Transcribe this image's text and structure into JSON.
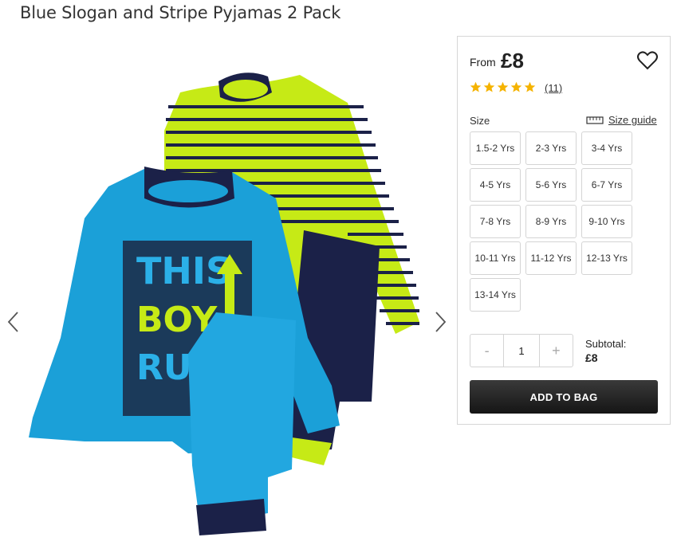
{
  "product": {
    "title": "Blue Slogan and Stripe Pyjamas 2 Pack",
    "image_alt": "Blue slogan pyjamas with lime and navy stripe pyjamas",
    "print": {
      "line1": "THIS",
      "line2": "BOY",
      "line3": "RUL"
    }
  },
  "gallery": {
    "prev_icon": "chevron-left-icon",
    "next_icon": "chevron-right-icon"
  },
  "purchase": {
    "from_label": "From",
    "price": "£8",
    "rating": 5,
    "review_count": "(11)",
    "size_label": "Size",
    "size_guide_label": "Size guide",
    "sizes": [
      "1.5-2 Yrs",
      "2-3 Yrs",
      "3-4 Yrs",
      "4-5 Yrs",
      "5-6 Yrs",
      "6-7 Yrs",
      "7-8 Yrs",
      "8-9 Yrs",
      "9-10 Yrs",
      "10-11 Yrs",
      "11-12 Yrs",
      "12-13 Yrs",
      "13-14 Yrs"
    ],
    "qty_minus": "-",
    "qty_value": "1",
    "qty_plus": "+",
    "subtotal_label": "Subtotal:",
    "subtotal_value": "£8",
    "add_to_bag": "ADD TO BAG"
  },
  "colors": {
    "star": "#f5b301",
    "button_dark": "#1e1e1e",
    "blue": "#1ba0d8",
    "lime": "#c6ea16",
    "navy": "#1b2148"
  }
}
